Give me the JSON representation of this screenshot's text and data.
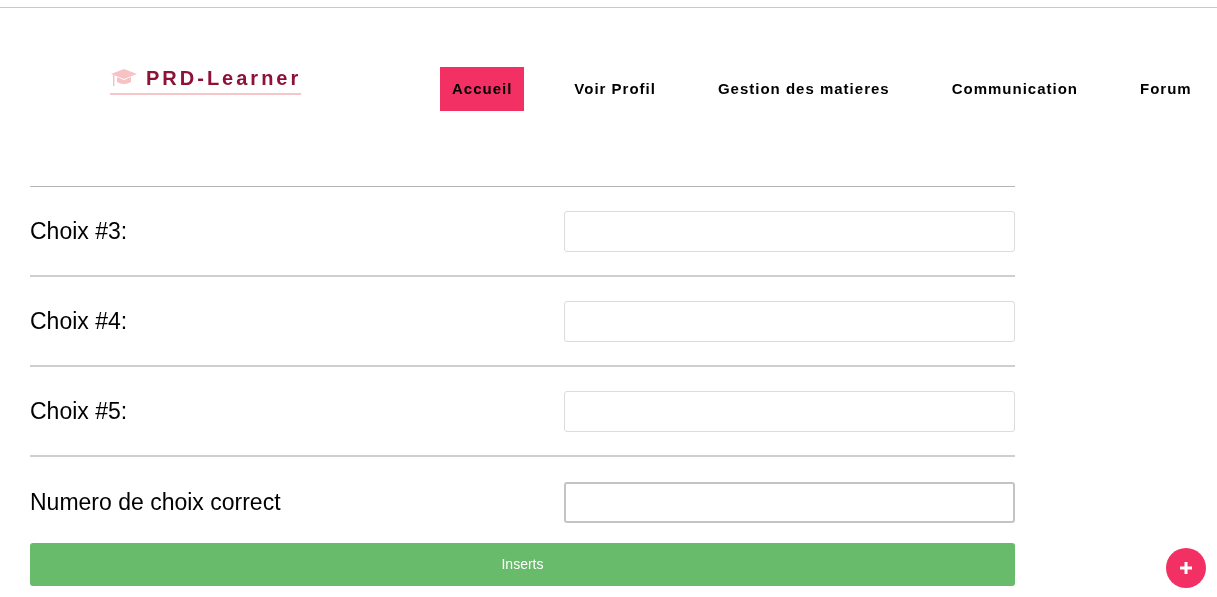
{
  "logo": {
    "text": "PRD-Learner"
  },
  "nav": [
    {
      "label": "Accueil",
      "selected": true
    },
    {
      "label": "Voir Profil",
      "selected": false
    },
    {
      "label": "Gestion des matieres",
      "selected": false
    },
    {
      "label": "Communication",
      "selected": false
    },
    {
      "label": "Forum",
      "selected": false
    }
  ],
  "fields": [
    {
      "label": "Choix #3:"
    },
    {
      "label": "Choix #4:"
    },
    {
      "label": "Choix #5:"
    },
    {
      "label": "Numero de choix correct"
    }
  ],
  "submit": {
    "label": "Inserts"
  }
}
